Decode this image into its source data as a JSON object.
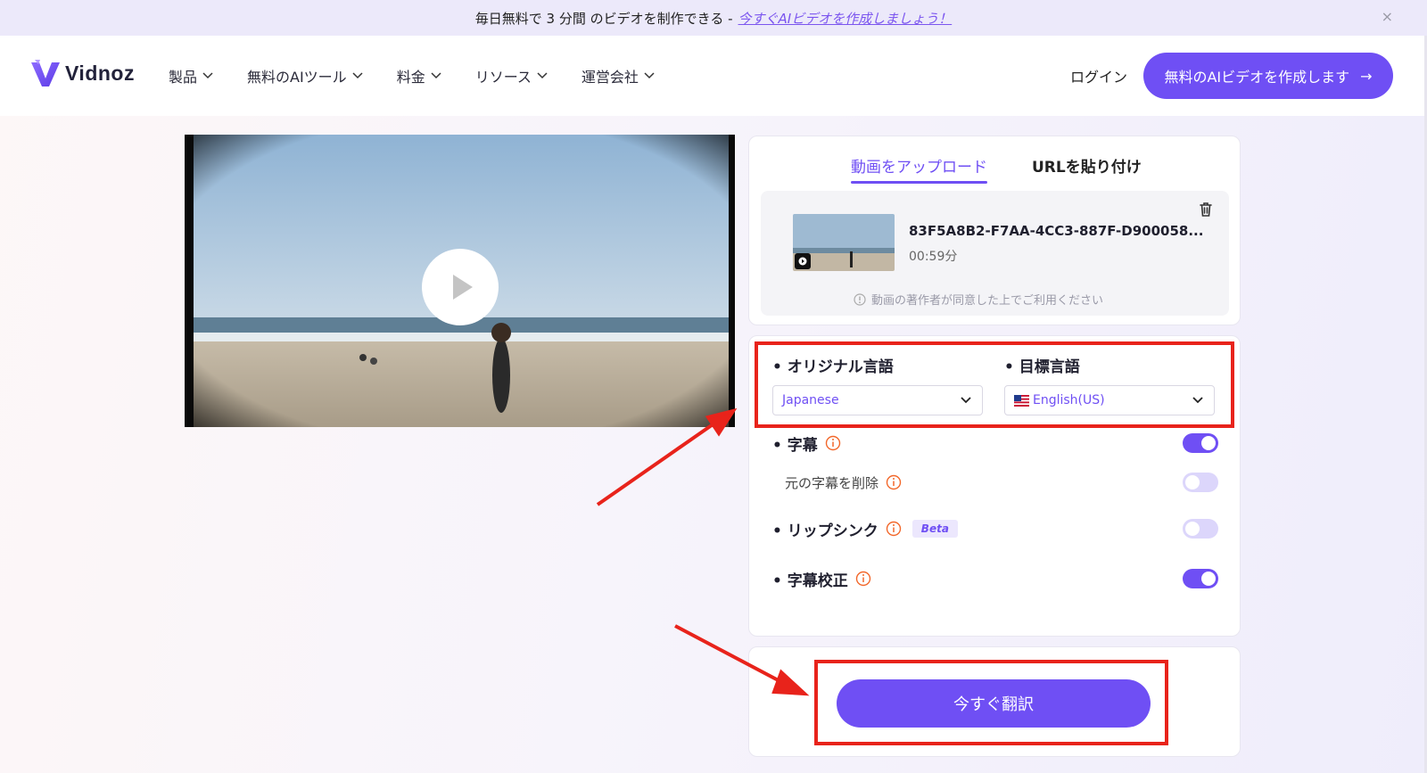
{
  "promo": {
    "text": "毎日無料で 3 分間 のビデオを制作できる -",
    "link": "今すぐAIビデオを作成しましょう！",
    "close": "×"
  },
  "header": {
    "logo": "Vidnoz",
    "nav": [
      {
        "label": "製品"
      },
      {
        "label": "無料のAIツール"
      },
      {
        "label": "料金"
      },
      {
        "label": "リソース"
      },
      {
        "label": "運営会社"
      }
    ],
    "login": "ログイン",
    "cta": "無料のAIビデオを作成します",
    "cta_arrow": "→"
  },
  "upload_panel": {
    "tabs": [
      "動画をアップロード",
      "URLを貼り付け"
    ],
    "active_tab": "動画をアップロード",
    "file_name": "83F5A8B2-F7AA-4CC3-887F-D900058...",
    "duration": "00:59分",
    "note": "動画の著作者が同意した上でご利用ください"
  },
  "settings": {
    "original_language_label": "• オリジナル言語",
    "target_language_label": "• 目標言語",
    "original_language": "Japanese",
    "target_language": "English(US)",
    "options": [
      {
        "label": "• 字幕",
        "on": true,
        "info": true,
        "beta": false,
        "sub": false
      },
      {
        "label": "元の字幕を削除",
        "on": false,
        "info": true,
        "beta": false,
        "sub": true
      },
      {
        "label": "• リップシンク",
        "on": false,
        "info": true,
        "beta": true,
        "sub": false
      },
      {
        "label": "• 字幕校正",
        "on": true,
        "info": true,
        "beta": false,
        "sub": false
      }
    ],
    "beta_badge": "Beta"
  },
  "translate_button": "今すぐ翻訳",
  "colors": {
    "accent": "#6f4ff4",
    "highlight": "#e8231b",
    "info_orange": "#f2672a"
  }
}
